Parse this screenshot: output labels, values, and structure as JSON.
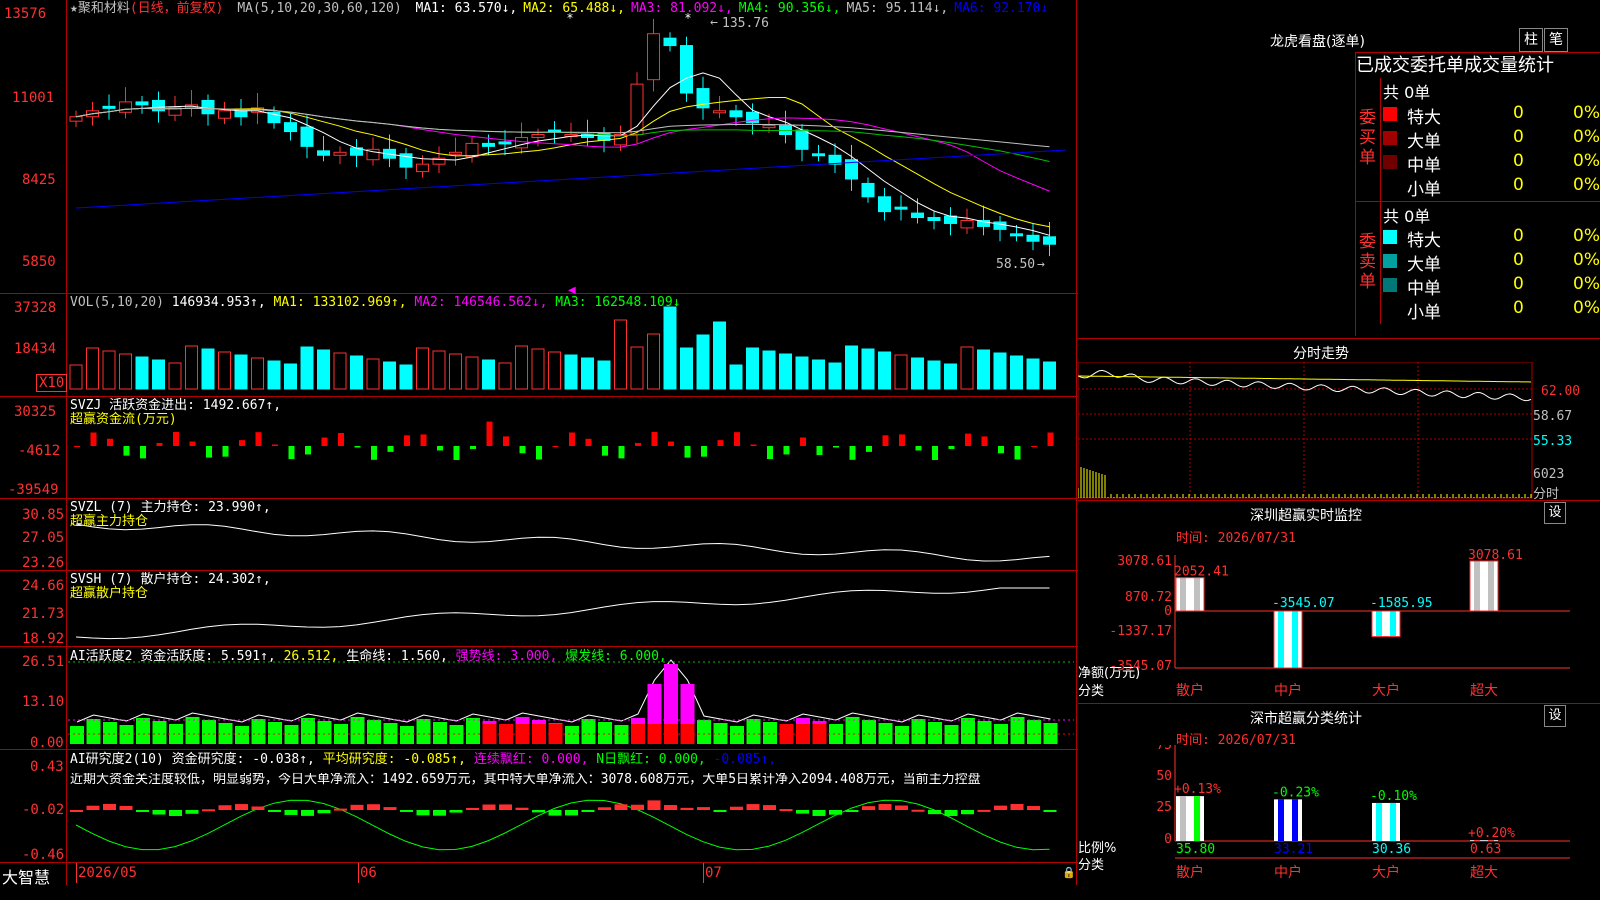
{
  "stock": {
    "title": "★聚和材料",
    "mode": "(日线，前复权)",
    "ma_prefix": "MA(5,10,20,30,60,120)",
    "ma_items": [
      {
        "label": "MA1:",
        "value": "63.570↓,",
        "color": "#ffffff"
      },
      {
        "label": "MA2:",
        "value": "65.488↓,",
        "color": "#ffff00"
      },
      {
        "label": "MA3:",
        "value": "81.092↓,",
        "color": "#ff00ff"
      },
      {
        "label": "MA4:",
        "value": "90.356↓,",
        "color": "#00ff00"
      },
      {
        "label": "MA5:",
        "value": "95.114↓,",
        "color": "#c0c0c0"
      },
      {
        "label": "MA6:",
        "value": "92.170↓",
        "color": "#0000ff"
      }
    ],
    "high_label": "135.76",
    "low_label": "58.50",
    "axis_labels": [
      "13576",
      "11001",
      "8425",
      "5850"
    ]
  },
  "vol": {
    "header": "VOL(5,10,20)",
    "value": "146934.953↑,",
    "ma1": "MA1: 133102.969↑,",
    "ma2": "MA2: 146546.562↓,",
    "ma3": "MA3: 162548.109↓",
    "axis_labels": [
      "37328",
      "18434"
    ],
    "unit": "X10"
  },
  "svzj": {
    "header": "SVZJ  活跃资金进出: 1492.667↑,",
    "sub": "超赢资金流(万元)",
    "axis_labels": [
      "30325",
      "-4612",
      "-39549"
    ]
  },
  "svzl": {
    "header": "SVZL (7) 主力持仓: 23.990↑,",
    "sub": "超赢主力持仓",
    "axis_labels": [
      "30.85",
      "27.05",
      "23.26"
    ]
  },
  "svsh": {
    "header": "SVSH (7) 散户持仓: 24.302↑,",
    "sub": "超赢散户持仓",
    "axis_labels": [
      "24.66",
      "21.73",
      "18.92"
    ]
  },
  "ai1": {
    "name": "AI活跃度2 资金活跃度:",
    "v1": "5.591↑,",
    "v2": "26.512,",
    "v3": "生命线: 1.560,",
    "v4": "强势线: 3.000,",
    "v5": "爆发线: 6.000,",
    "axis_labels": [
      "26.51",
      "13.10",
      "0.00"
    ]
  },
  "ai2": {
    "name": "AI研究度2(10) 资金研究度: -0.038↑,",
    "v1": "平均研究度: -0.085↑,",
    "v2": "连续飘红: 0.000,",
    "v3": "N日飘红: 0.000,",
    "v4": "-0.085↑,",
    "desc": "近期大资金关注度较低，明显弱势，今日大单净流入：1492.659万元，其中特大单净流入：3078.608万元，大单5日累计净入2094.408万元，当前主力控盘",
    "axis_labels": [
      "0.43",
      "-0.02",
      "-0.46"
    ]
  },
  "bottom": {
    "brand": "大智慧",
    "dates": [
      "2026/05",
      "06",
      "07"
    ]
  },
  "right": {
    "lhb_title": "龙虎看盘(逐单)",
    "btn_zhu": "柱",
    "btn_bi": "笔",
    "tabs": "已成交委托单成交量统计",
    "buy_total": "共 0单",
    "sell_total": "共 0单",
    "buy_label": "委买单",
    "sell_label": "委卖单",
    "rows_buy": [
      {
        "name": "特大",
        "v": "0",
        "p": "0%",
        "color": "#ff0000"
      },
      {
        "name": "大单",
        "v": "0",
        "p": "0%",
        "color": "#a00000"
      },
      {
        "name": "中单",
        "v": "0",
        "p": "0%",
        "color": "#700000"
      },
      {
        "name": "小单",
        "v": "0",
        "p": "0%",
        "color": ""
      }
    ],
    "rows_sell": [
      {
        "name": "特大",
        "v": "0",
        "p": "0%",
        "color": "#00ffff"
      },
      {
        "name": "大单",
        "v": "0",
        "p": "0%",
        "color": "#00a0a0"
      },
      {
        "name": "中单",
        "v": "0",
        "p": "0%",
        "color": "#007878"
      },
      {
        "name": "小单",
        "v": "0",
        "p": "0%",
        "color": ""
      }
    ],
    "fs_title": "分时走势",
    "fs_labels": [
      "62.00",
      "58.67",
      "55.33",
      "6023",
      "分时"
    ],
    "sz_title": "深圳超赢实时监控",
    "set_btn": "设",
    "sz_time": "时间: 2026/07/31",
    "sz_axis": [
      "3078.61",
      "870.72",
      "0",
      "-1337.17",
      "-3545.07"
    ],
    "sz_bottom": [
      "净额(万元)",
      "分类"
    ],
    "sz_bars": [
      {
        "name": "散户",
        "value": 2052.41,
        "label": "2052.41"
      },
      {
        "name": "中户",
        "value": -3545.07,
        "label": "-3545.07"
      },
      {
        "name": "大户",
        "value": -1585.95,
        "label": "-1585.95"
      },
      {
        "name": "超大",
        "value": 3078.61,
        "label": "3078.61"
      }
    ],
    "sm_title": "深市超赢分类统计",
    "sm_time": "时间: 2026/07/31",
    "sm_axis": [
      "75",
      "50",
      "25",
      "0"
    ],
    "sm_bottom": [
      "比例%",
      "分类"
    ],
    "sm_bars": [
      {
        "name": "散户",
        "value": 35.8,
        "label": "35.80",
        "chg": "+0.13%"
      },
      {
        "name": "中户",
        "value": 33.21,
        "label": "33.21",
        "chg": "-0.23%"
      },
      {
        "name": "大户",
        "value": 30.36,
        "label": "30.36",
        "chg": "-0.10%"
      },
      {
        "name": "超大",
        "value": 0.63,
        "label": "0.63",
        "chg": "+0.20%"
      }
    ]
  },
  "chart_data": {
    "type": "bar",
    "title": "深圳超赢实时监控",
    "categories": [
      "散户",
      "中户",
      "大户",
      "超大"
    ],
    "series": [
      {
        "name": "净额(万元)",
        "values": [
          2052.41,
          -3545.07,
          -1585.95,
          3078.61
        ]
      }
    ],
    "ylim": [
      -3545.07,
      3078.61
    ]
  }
}
